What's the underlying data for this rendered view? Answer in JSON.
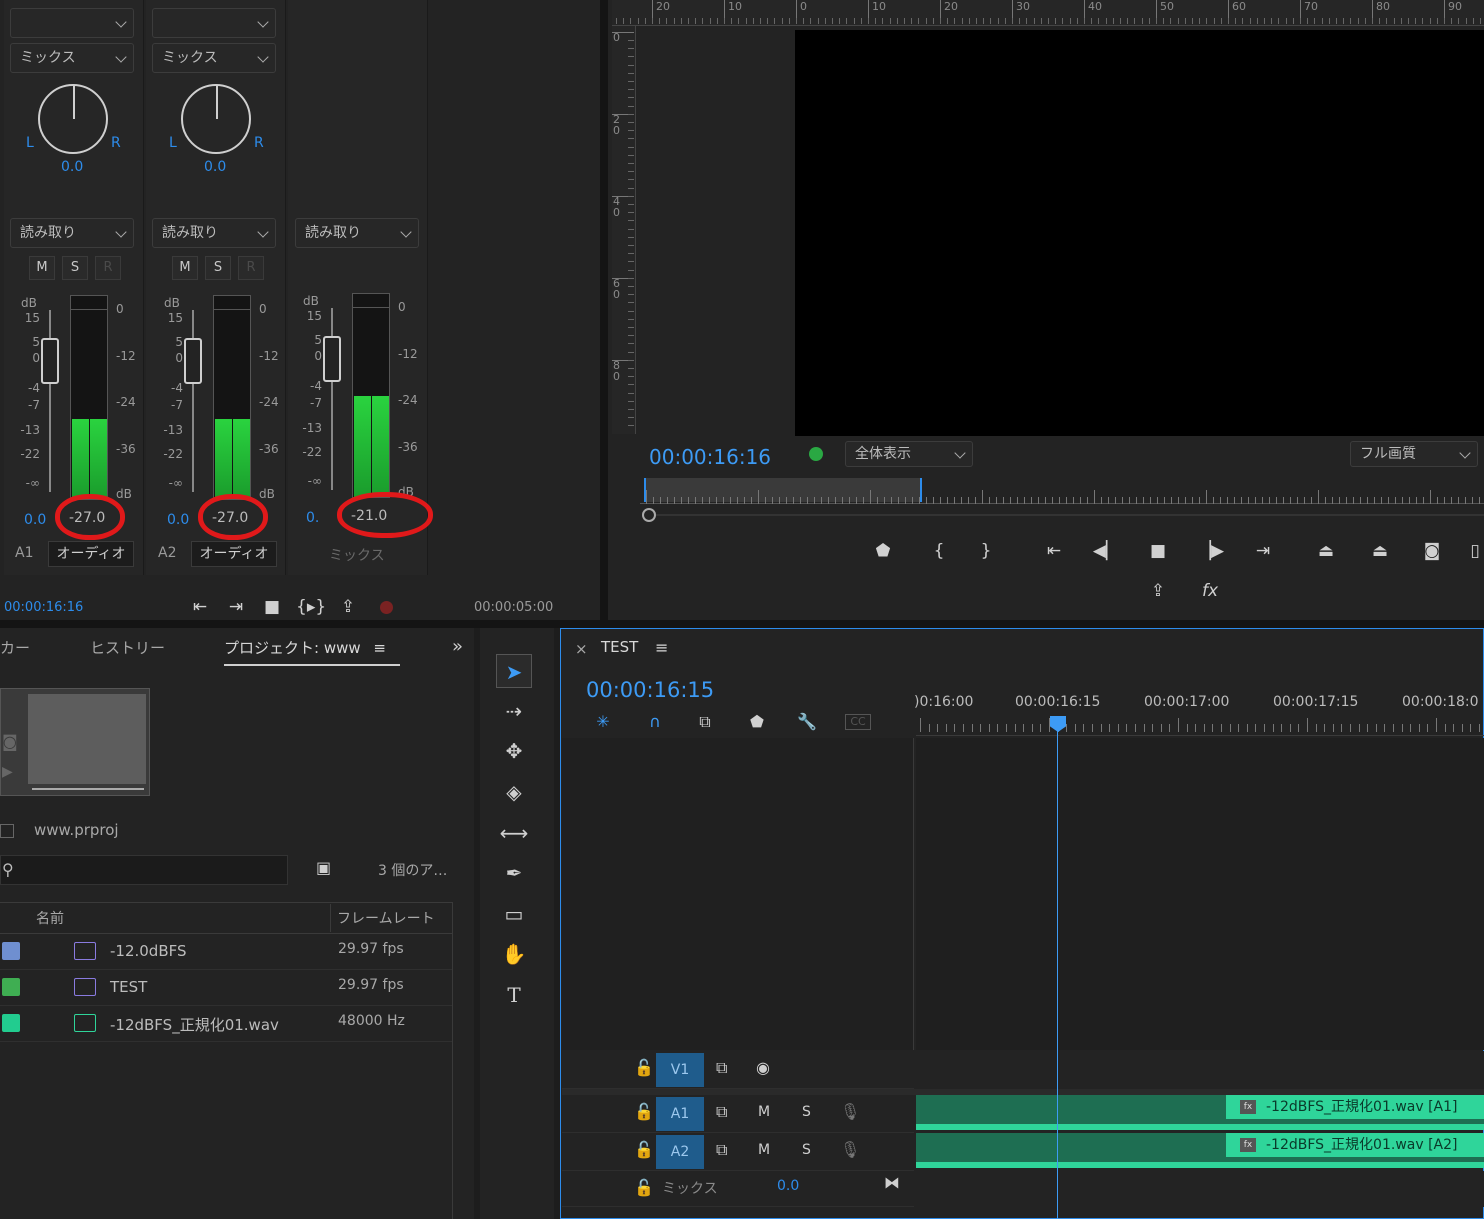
{
  "mixer": {
    "channels": [
      {
        "top_value": "",
        "mix": "ミックス",
        "pan_l": "L",
        "pan_r": "R",
        "pan_value": "0.0",
        "read": "読み取り",
        "m": "M",
        "s": "S",
        "r": "R",
        "db": "dB",
        "vol_value": "0.0",
        "meter_readout": "-27.0",
        "track": "A1",
        "name": "オーディオ"
      },
      {
        "top_value": "",
        "mix": "ミックス",
        "pan_l": "L",
        "pan_r": "R",
        "pan_value": "0.0",
        "read": "読み取り",
        "m": "M",
        "s": "S",
        "r": "R",
        "db": "dB",
        "vol_value": "0.0",
        "meter_readout": "-27.0",
        "track": "A2",
        "name": "オーディオ"
      },
      {
        "read": "読み取り",
        "db": "dB",
        "vol_value": "0.",
        "meter_readout": "-21.0",
        "name": "ミックス"
      }
    ],
    "fader_scale": [
      "15",
      "5",
      "0",
      "-4",
      "-7",
      "-13",
      "-22",
      "-∞"
    ],
    "meter_scale": [
      "0",
      "-12",
      "-24",
      "-36",
      "dB"
    ],
    "meter_levels": [
      0.42,
      0.42,
      0.53
    ],
    "timecode": "00:00:16:16",
    "duration": "00:00:05:00"
  },
  "monitor": {
    "ruler_labels": [
      "20",
      "10",
      "0",
      "10",
      "20",
      "30",
      "40",
      "50",
      "60",
      "70",
      "80",
      "90"
    ],
    "vruler_labels": [
      "0",
      "2\n0",
      "4\n0",
      "6\n0",
      "8\n0"
    ],
    "timecode": "00:00:16:16",
    "fit": "全体表示",
    "quality": "フル画質",
    "fx": "fx"
  },
  "project": {
    "tabs": [
      "カー",
      "ヒストリー",
      "プロジェクト: www"
    ],
    "file": "www.prproj",
    "item_count": "3 個のア…",
    "col_name": "名前",
    "col_fps": "フレームレート",
    "rows": [
      {
        "name": "-12.0dBFS",
        "fps": "29.97 fps",
        "color": "#6f8fd0"
      },
      {
        "name": "TEST",
        "fps": "29.97 fps",
        "color": "#3fae52"
      },
      {
        "name": "-12dBFS_正規化01.wav",
        "fps": "48000 Hz",
        "color": "#22cc8f"
      }
    ]
  },
  "timeline": {
    "close": "×",
    "title": "TEST",
    "timecode": "00:00:16:15",
    "ruler": [
      ")0:16:00",
      "00:00:16:15",
      "00:00:17:00",
      "00:00:17:15",
      "00:00:18:0"
    ],
    "tracks": {
      "v1": "V1",
      "a1": "A1",
      "a2": "A2",
      "m": "M",
      "s": "S",
      "mix": "ミックス",
      "mix_value": "0.0"
    },
    "clips": [
      "-12dBFS_正規化01.wav [A1]",
      "-12dBFS_正規化01.wav [A2]"
    ],
    "fx": "fx"
  }
}
